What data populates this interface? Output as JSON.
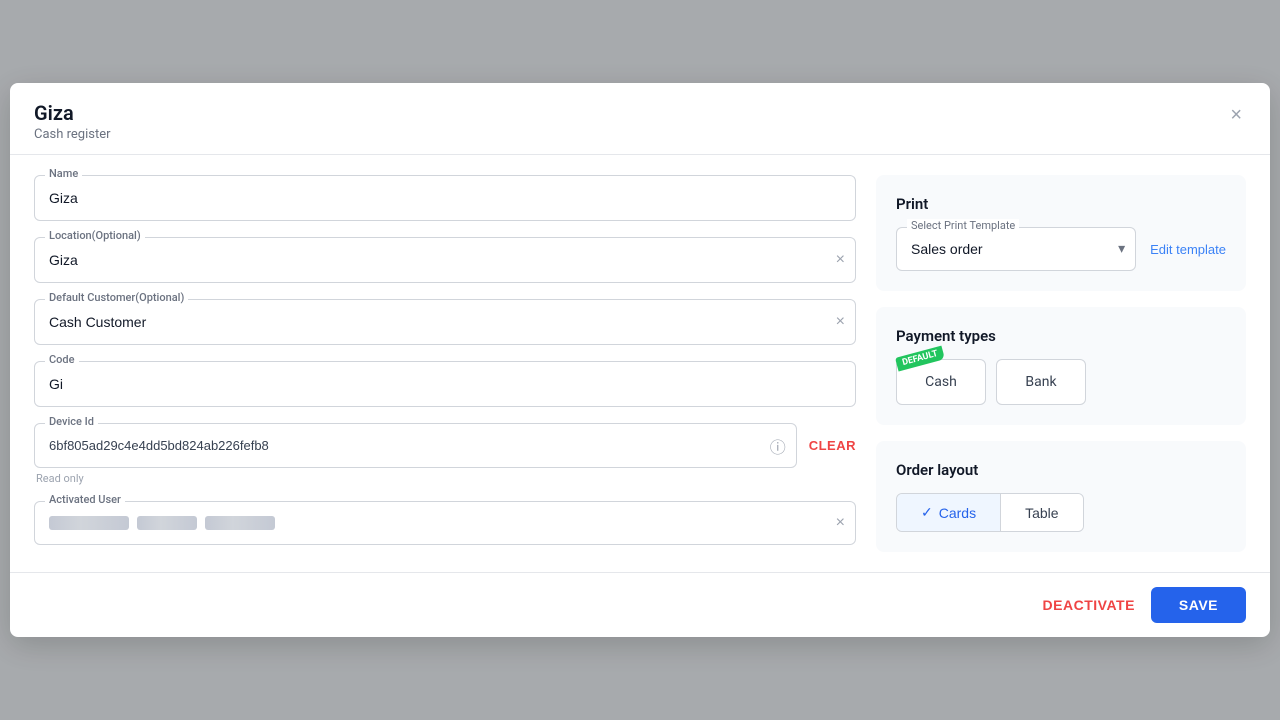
{
  "modal": {
    "title": "Giza",
    "subtitle": "Cash register",
    "close_label": "×"
  },
  "left": {
    "name_label": "Name",
    "name_value": "Giza",
    "location_label": "Location(Optional)",
    "location_value": "Giza",
    "default_customer_label": "Default Customer(Optional)",
    "default_customer_value": "Cash Customer",
    "code_label": "Code",
    "code_value": "Gi",
    "device_id_label": "Device Id",
    "device_id_value": "6bf805ad29c4e4dd5bd824ab226fefb8",
    "read_only_text": "Read only",
    "clear_label": "CLEAR",
    "activated_user_label": "Activated User"
  },
  "right": {
    "print_section_title": "Print",
    "select_print_template_label": "Select Print Template",
    "select_print_template_value": "Sales order",
    "edit_template_label": "Edit template",
    "payment_types_title": "Payment types",
    "payment_types": [
      {
        "label": "Cash",
        "default": true
      },
      {
        "label": "Bank",
        "default": false
      }
    ],
    "order_layout_title": "Order layout",
    "layout_buttons": [
      {
        "label": "Cards",
        "active": true
      },
      {
        "label": "Table",
        "active": false
      }
    ]
  },
  "footer": {
    "deactivate_label": "DEACTIVATE",
    "save_label": "SAVE"
  },
  "icons": {
    "close": "×",
    "clear_field": "×",
    "info": "ⓘ",
    "chevron_down": "▾",
    "check": "✓"
  }
}
